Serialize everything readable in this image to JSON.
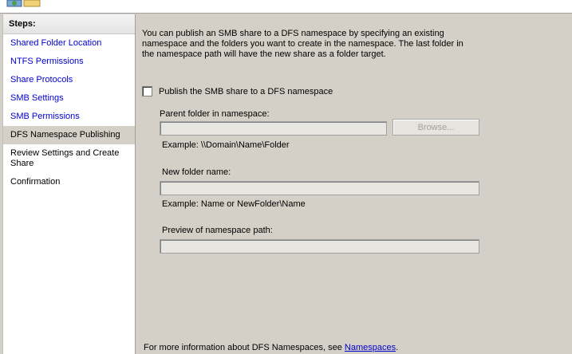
{
  "steps": {
    "title": "Steps:",
    "items": [
      {
        "label": "Shared Folder Location"
      },
      {
        "label": "NTFS Permissions"
      },
      {
        "label": "Share Protocols"
      },
      {
        "label": "SMB Settings"
      },
      {
        "label": "SMB Permissions"
      },
      {
        "label": "DFS Namespace Publishing"
      },
      {
        "label": "Review Settings and Create Share"
      },
      {
        "label": "Confirmation"
      }
    ]
  },
  "main": {
    "intro": "You can publish an SMB share to a DFS namespace by specifying an existing namespace and the folders you want to create in the namespace. The last folder in the namespace path will have the new share as a folder target.",
    "publish_checkbox_label": "Publish the SMB share to a DFS namespace",
    "publish_checked": false,
    "parent_folder_label": "Parent folder in namespace:",
    "parent_folder_value": "",
    "browse_button": "Browse...",
    "parent_example": "Example: \\\\Domain\\Name\\Folder",
    "new_folder_label": "New folder name:",
    "new_folder_value": "",
    "new_folder_example": "Example: Name or NewFolder\\Name",
    "preview_label": "Preview of namespace path:",
    "preview_value": ""
  },
  "footer": {
    "text": "For more information about DFS Namespaces, see ",
    "link": "Namespaces",
    "suffix": "."
  },
  "colors": {
    "link": "#0000cc",
    "active_step_bg": "#d4d0c8",
    "window_bg": "#d4d0c8"
  },
  "icons": {
    "header": "share-wizard-icon"
  }
}
